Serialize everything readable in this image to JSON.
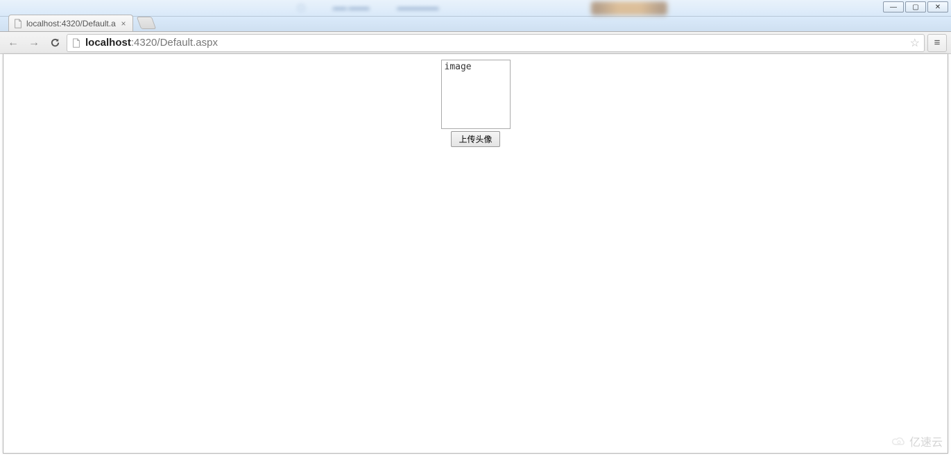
{
  "window": {
    "controls": {
      "minimize": "—",
      "maximize": "▢",
      "close": "✕"
    }
  },
  "tabs": [
    {
      "title": "localhost:4320/Default.a"
    }
  ],
  "toolbar": {
    "back": "←",
    "forward": "→",
    "reload": "↻"
  },
  "address": {
    "host": "localhost",
    "rest": ":4320/Default.aspx",
    "star": "☆",
    "menu": "≡"
  },
  "page": {
    "img_alt": "image",
    "upload_label": "上传头像"
  },
  "watermark": {
    "text": "亿速云"
  }
}
